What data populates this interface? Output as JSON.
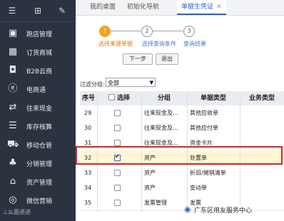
{
  "sidebar": {
    "items": [
      {
        "label": "跑店管理",
        "icon": "id-card-icon",
        "glyph": "▣"
      },
      {
        "label": "订货商城",
        "icon": "store-icon",
        "glyph": "▦"
      },
      {
        "label": "B2B云商",
        "icon": "bag-icon",
        "glyph": "◘"
      },
      {
        "label": "电商通",
        "icon": "e-commerce-icon",
        "glyph": "ⓔ"
      },
      {
        "label": "往来现金",
        "icon": "exchange-icon",
        "glyph": "⇄"
      },
      {
        "label": "库存核算",
        "icon": "inventory-icon",
        "glyph": "☰"
      },
      {
        "label": "移动仓管",
        "icon": "truck-icon",
        "glyph": "⛟"
      },
      {
        "label": "分销管理",
        "icon": "hierarchy-icon",
        "glyph": "♣"
      },
      {
        "label": "资产管理",
        "icon": "asset-icon",
        "glyph": "⌂"
      },
      {
        "label": "微信营销",
        "icon": "wechat-icon",
        "glyph": "◎"
      }
    ],
    "bottom_label": "⊥么面进进"
  },
  "tabs": [
    {
      "label": "我的桌面"
    },
    {
      "label": "初始化导航"
    },
    {
      "label": "单据生凭证"
    }
  ],
  "wizard": {
    "steps": [
      {
        "num": "1",
        "label": "选择来源单据"
      },
      {
        "num": "2",
        "label": "选择查询条件"
      },
      {
        "num": "3",
        "label": "查询结果"
      }
    ],
    "next_label": "下一步",
    "exit_label": "退出"
  },
  "filter": {
    "label": "过滤分组:",
    "value": "全部"
  },
  "table": {
    "headers": [
      "序号",
      "选择",
      "分组",
      "单据类型",
      "业务类型"
    ],
    "rows": [
      {
        "seq": "29",
        "group": "往来现金及…",
        "type": "其他应收单",
        "checked": false,
        "selected": false
      },
      {
        "seq": "30",
        "group": "往来现金及…",
        "type": "其他应付单",
        "checked": false,
        "selected": false
      },
      {
        "seq": "31",
        "group": "往来现金及…",
        "type": "资金卡片",
        "checked": false,
        "selected": false
      },
      {
        "seq": "32",
        "group": "资产",
        "type": "处置单",
        "checked": true,
        "selected": true
      },
      {
        "seq": "33",
        "group": "资产",
        "type": "折旧/摊销清单",
        "checked": false,
        "selected": false
      },
      {
        "seq": "34",
        "group": "资产",
        "type": "变动单",
        "checked": false,
        "selected": false
      },
      {
        "seq": "35",
        "group": "发票管理",
        "type": "发票",
        "checked": false,
        "selected": false
      }
    ]
  },
  "watermark": "广东区用友服务中心",
  "colors": {
    "sidebar_bg": "#2b3340",
    "accent": "#2a64c5",
    "step_active": "#f7a11a",
    "highlight": "#d9251d",
    "selected_row": "#fdf7d4"
  }
}
